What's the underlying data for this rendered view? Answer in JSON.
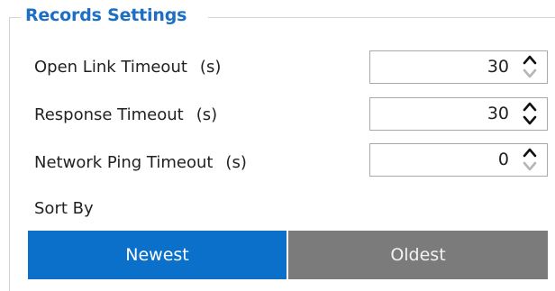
{
  "group": {
    "title": "Records Settings"
  },
  "fields": [
    {
      "label": "Open Link Timeout",
      "unit": "(s)",
      "value": "30",
      "up_enabled": true,
      "down_enabled": false
    },
    {
      "label": "Response Timeout",
      "unit": "(s)",
      "value": "30",
      "up_enabled": true,
      "down_enabled": true
    },
    {
      "label": "Network Ping Timeout",
      "unit": "(s)",
      "value": "0",
      "up_enabled": true,
      "down_enabled": false
    }
  ],
  "sort": {
    "label": "Sort By",
    "options": [
      "Newest",
      "Oldest"
    ],
    "selected": "Newest"
  },
  "colors": {
    "accent": "#1c6fc4",
    "selected_bg": "#0a70c9",
    "unselected_bg": "#7b7b7b",
    "arrow_enabled": "#111111",
    "arrow_disabled": "#b5b5b5"
  }
}
